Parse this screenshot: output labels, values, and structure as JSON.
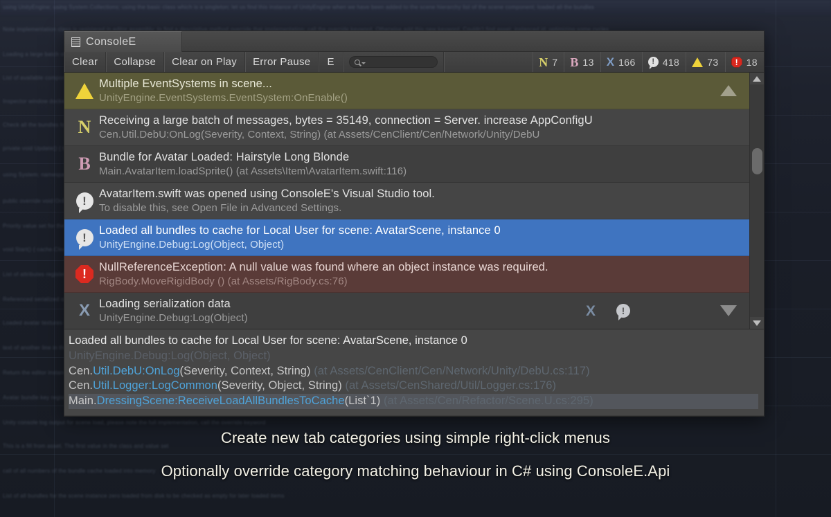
{
  "window": {
    "tab_title": "ConsoleE",
    "tab_icon": "list-lines-icon"
  },
  "toolbar": {
    "clear_label": "Clear",
    "collapse_label": "Collapse",
    "clear_on_play_label": "Clear on Play",
    "error_pause_label": "Error Pause",
    "e_label": "E",
    "search_placeholder": "",
    "search_value": "",
    "search_icon": "search-icon",
    "counters": [
      {
        "icon": "letter-n-icon",
        "glyph": "N",
        "count": "7",
        "color": "#d6cf6a"
      },
      {
        "icon": "letter-b-icon",
        "glyph": "B",
        "count": "13",
        "color": "#d9a7bd"
      },
      {
        "icon": "blue-x-icon",
        "glyph": "X",
        "count": "166",
        "color": "#7f9cc4"
      },
      {
        "icon": "info-icon",
        "glyph": "!",
        "count": "418",
        "color": "#e2e2e2"
      },
      {
        "icon": "warning-icon",
        "glyph": "!",
        "count": "73",
        "color": "#efd33a"
      },
      {
        "icon": "error-icon",
        "glyph": "!",
        "count": "18",
        "color": "#d8281f"
      }
    ]
  },
  "log_rows": [
    {
      "icon": "warning-icon",
      "style": "warn",
      "message": "Multiple EventSystems in scene...",
      "stack": "UnityEngine.EventSystems.EventSystem:OnEnable()"
    },
    {
      "icon": "letter-n-icon",
      "style": "dark",
      "message": "Receiving a large batch of messages, bytes = 35149, connection = Server. increase AppConfigU",
      "stack": "Cen.Util.DebU:OnLog(Severity, Context, String) (at Assets/CenClient/Cen/Network/Unity/DebU"
    },
    {
      "icon": "letter-b-icon",
      "style": "darker",
      "message": "Bundle for Avatar Loaded: Hairstyle Long Blonde",
      "stack": "Main.AvatarItem.loadSprite() (at Assets\\Item\\AvatarItem.swift:116)"
    },
    {
      "icon": "info-icon",
      "style": "dark",
      "message": "AvatarItem.swift was opened using ConsoleE's Visual Studio tool.",
      "stack": "To disable this, see Open File in Advanced Settings."
    },
    {
      "icon": "info-icon",
      "style": "sel",
      "message": "Loaded all bundles to cache for Local User for scene: AvatarScene, instance 0",
      "stack": "UnityEngine.Debug:Log(Object, Object)"
    },
    {
      "icon": "error-icon",
      "style": "err",
      "message": "NullReferenceException: A null value was found where an object instance was required.",
      "stack": "RigBody.MoveRigidBody () (at Assets/RigBody.cs:76)"
    },
    {
      "icon": "blue-x-icon",
      "style": "darker",
      "message": "Loading serialization data",
      "stack": "UnityEngine.Debug:Log(Object)"
    }
  ],
  "row_actions": {
    "x_icon": "blue-x-icon",
    "info_icon": "info-icon",
    "collapse_up_icon": "triangle-up-icon",
    "collapse_down_icon": "triangle-down-icon"
  },
  "scrollbar": {
    "up_arrow_icon": "scroll-up-arrow-icon",
    "down_arrow_icon": "scroll-down-arrow-icon"
  },
  "detail": {
    "line1": "Loaded all bundles to cache for Local User for scene: AvatarScene, instance 0",
    "line2": "UnityEngine.Debug:Log(Object, Object)",
    "line3_ns": "Cen.",
    "line3_cls": "Util.DebU:",
    "line3_fn": "OnLog",
    "line3_args": "(Severity, Context, String)",
    "line3_path": " (at Assets/CenClient/Cen/Network/Unity/DebU.cs:117)",
    "line4_ns": "Cen.",
    "line4_cls": "Util.Logger:",
    "line4_fn": "LogCommon",
    "line4_args": "(Severity, Object, String)",
    "line4_path": " (at Assets/CenShared/Util/Logger.cs:176)",
    "line5_ns": "Main.",
    "line5_cls": "DressingScene:",
    "line5_fn": "ReceiveLoadAllBundlesToCache",
    "line5_args": "(List`1)",
    "line5_path": " (at Assets/Cen/Refactor/Scene.U.cs:295)"
  },
  "captions": {
    "line1": "Create new tab categories using simple right-click menus",
    "line2": "Optionally override category matching behaviour in C# using ConsoleE.Api"
  },
  "colors": {
    "window_bg": "#3b3b3b",
    "selected_row": "#3f74c0",
    "warning_row": "#5b5a38",
    "error_row": "#5a3b38",
    "accent_link": "#4fa3d9"
  }
}
